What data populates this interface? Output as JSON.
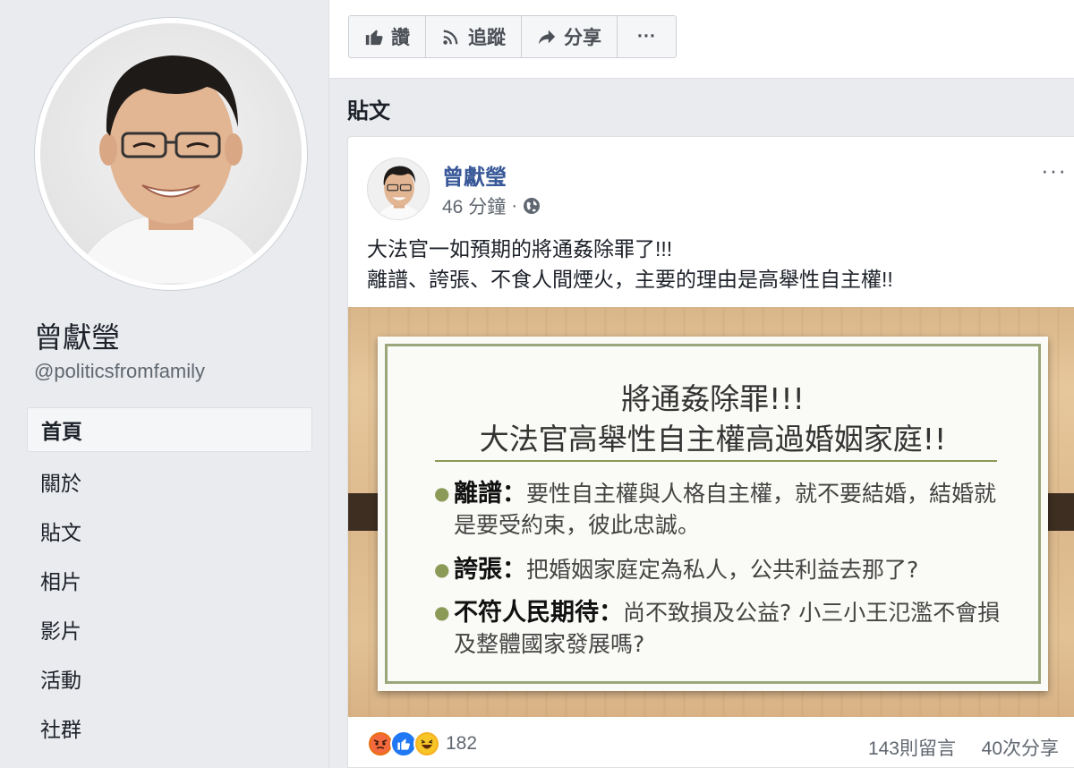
{
  "sidebar": {
    "page_name": "曾獻瑩",
    "handle": "@politicsfromfamily",
    "nav": [
      "首頁",
      "關於",
      "貼文",
      "相片",
      "影片",
      "活動",
      "社群"
    ],
    "active_index": 0
  },
  "actions": {
    "like": "讚",
    "follow": "追蹤",
    "share": "分享",
    "more": "···"
  },
  "posts_heading": "貼文",
  "post": {
    "author": "曾獻瑩",
    "time": "46 分鐘",
    "separator": "·",
    "menu": "···",
    "text_line1": "大法官一如預期的將通姦除罪了!!!",
    "text_line2": "離譜、誇張、不食人間煙火，主要的理由是高舉性自主權!!",
    "slide": {
      "title1": "將通姦除罪!!!",
      "title2": "大法官高舉性自主權高過婚姻家庭!!",
      "bullets": [
        {
          "keyword": "離譜：",
          "text": "要性自主權與人格自主權，就不要結婚，結婚就是要受約束，彼此忠誠。"
        },
        {
          "keyword": "誇張：",
          "text": "把婚姻家庭定為私人，公共利益去那了?"
        },
        {
          "keyword": "不符人民期待：",
          "text": "尚不致損及公益? 小三小王氾濫不會損及整體國家發展嗎?"
        }
      ]
    },
    "reaction_icons": [
      "angry-icon",
      "like-icon",
      "haha-icon"
    ],
    "reaction_count": "182",
    "comments": "143則留言",
    "shares": "40次分享"
  },
  "colors": {
    "link": "#385898",
    "bg": "#e9ebee",
    "accent_green": "#8b9a56"
  }
}
